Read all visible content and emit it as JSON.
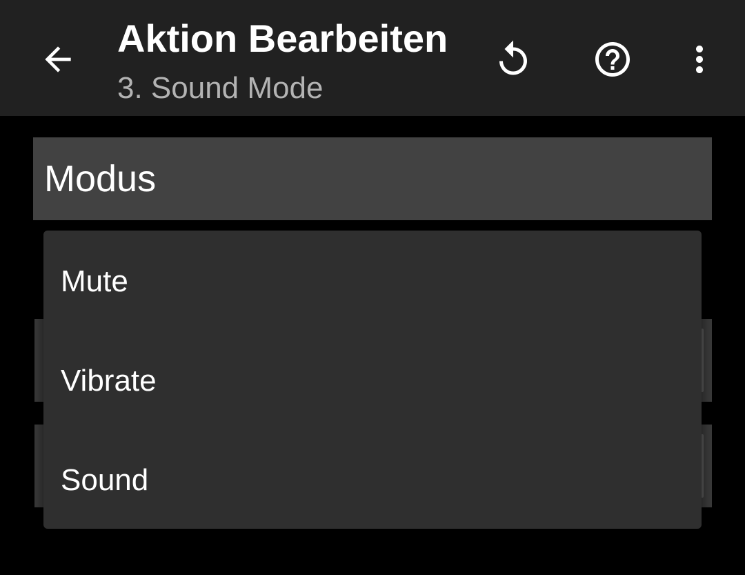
{
  "toolbar": {
    "title": "Aktion Bearbeiten",
    "subtitle": "3. Sound Mode",
    "icons": {
      "back": "arrow-back-icon",
      "reset": "reset-icon",
      "help": "help-icon",
      "more": "more-vert-icon"
    }
  },
  "section": {
    "label": "Modus"
  },
  "dropdown": {
    "options": [
      {
        "label": "Mute"
      },
      {
        "label": "Vibrate"
      },
      {
        "label": "Sound"
      }
    ]
  },
  "colors": {
    "toolbar_bg": "#212121",
    "page_bg": "#000000",
    "section_bg": "#424242",
    "popup_bg": "#2f2f2f",
    "subtitle_text": "#b3b3b3"
  }
}
